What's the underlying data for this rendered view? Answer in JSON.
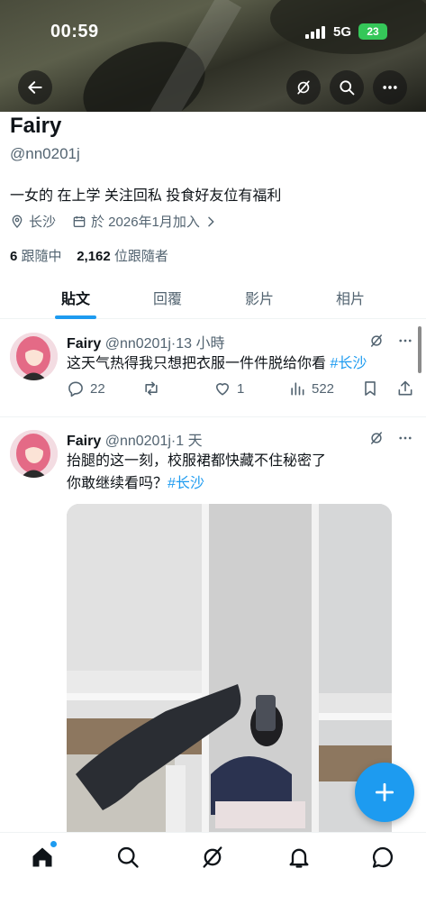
{
  "status_bar": {
    "time": "00:59",
    "network": "5G",
    "battery": "23"
  },
  "profile": {
    "name": "Fairy",
    "handle": "@nn0201j",
    "bio": "一女的 在上学 关注回私 投食好友位有福利",
    "location": "长沙",
    "joined": "於 2026年1月加入",
    "following_count": "6",
    "following_label": "跟隨中",
    "followers_count": "2,162",
    "followers_label": "位跟隨者"
  },
  "tabs": [
    {
      "label": "貼文",
      "active": true
    },
    {
      "label": "回覆",
      "active": false
    },
    {
      "label": "影片",
      "active": false
    },
    {
      "label": "相片",
      "active": false
    }
  ],
  "tweets": [
    {
      "name": "Fairy",
      "handle": "@nn0201j",
      "time": "13 小時",
      "text": "这天气热得我只想把衣服一件件脱给你看",
      "hashtag": "#长沙",
      "replies": "22",
      "reposts": "",
      "likes": "1",
      "views": "522"
    },
    {
      "name": "Fairy",
      "handle": "@nn0201j",
      "time": "1 天",
      "text_line1": "抬腿的这一刻，校服裙都快藏不住秘密了",
      "text_line2": "你敢继续看吗？",
      "hashtag": "#长沙"
    }
  ],
  "colors": {
    "accent": "#1d9bf0",
    "text": "#0f1419",
    "secondary": "#536471"
  }
}
